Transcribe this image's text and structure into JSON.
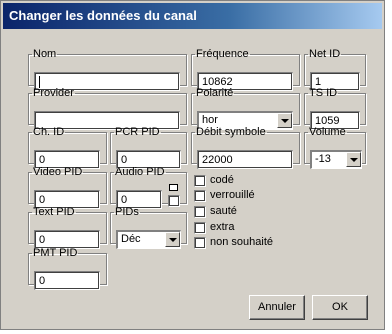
{
  "dialog": {
    "title": "Changer les données du canal"
  },
  "fields": {
    "nom": {
      "label": "Nom",
      "value": ""
    },
    "frequence": {
      "label": "Fréquence",
      "value": "10862"
    },
    "net_id": {
      "label": "Net ID",
      "value": "1"
    },
    "provider": {
      "label": "Provider",
      "value": ""
    },
    "polarite": {
      "label": "Polarité",
      "value": "hor"
    },
    "ts_id": {
      "label": "TS ID",
      "value": "1059"
    },
    "ch_id": {
      "label": "Ch. ID",
      "value": "0"
    },
    "pcr_pid": {
      "label": "PCR PID",
      "value": "0"
    },
    "debit_symbole": {
      "label": "Débit symbole",
      "value": "22000"
    },
    "volume": {
      "label": "Volume",
      "value": "-13"
    },
    "video_pid": {
      "label": "Video PID",
      "value": "0"
    },
    "audio_pid": {
      "label": "Audio PID",
      "value": "0"
    },
    "text_pid": {
      "label": "Text PID",
      "value": "0"
    },
    "pids": {
      "label": "PIDs",
      "value": "Déc"
    },
    "pmt_pid": {
      "label": "PMT PID",
      "value": "0"
    }
  },
  "checkboxes": [
    {
      "label": "codé",
      "checked": false
    },
    {
      "label": "verrouillé",
      "checked": false
    },
    {
      "label": "sauté",
      "checked": false
    },
    {
      "label": "extra",
      "checked": false
    },
    {
      "label": "non souhaité",
      "checked": false
    }
  ],
  "buttons": {
    "cancel": "Annuler",
    "ok": "OK"
  }
}
